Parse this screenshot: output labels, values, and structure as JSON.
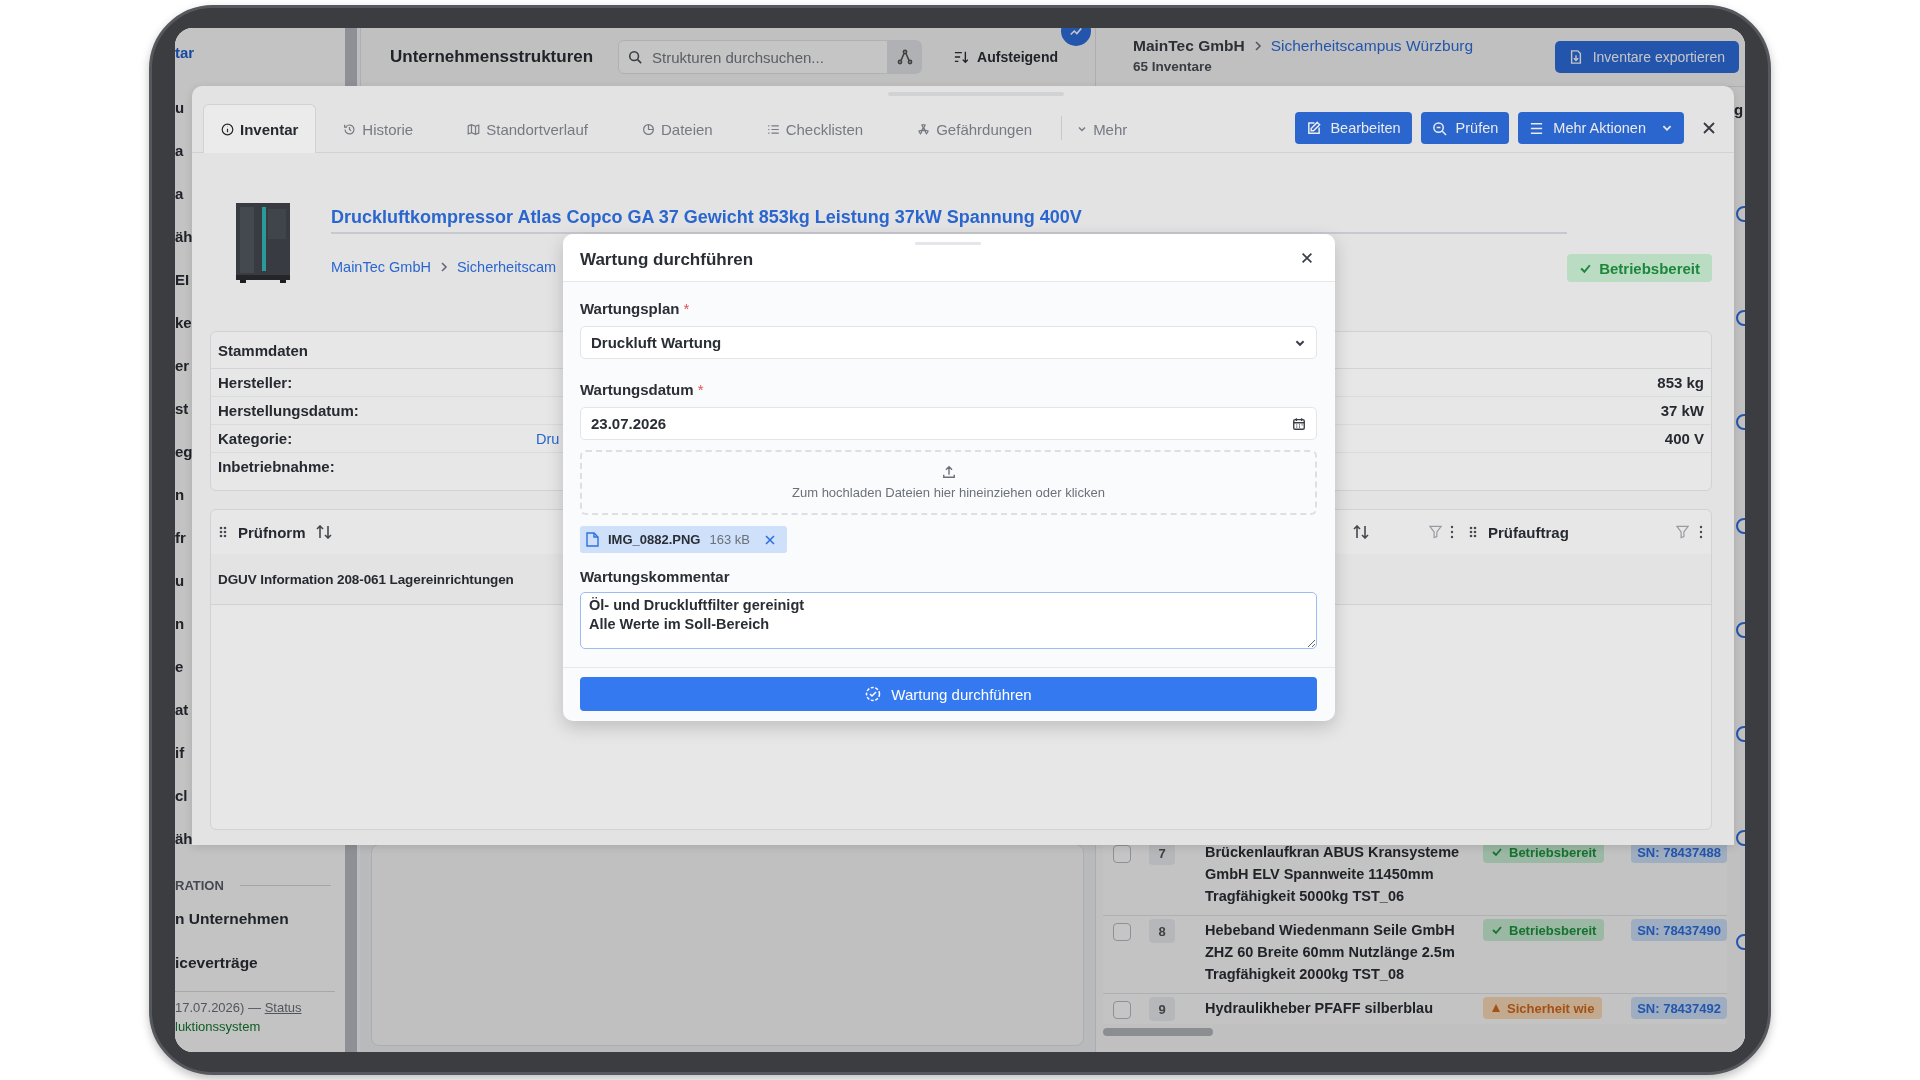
{
  "background": {
    "sidebar": {
      "top_link": "tar",
      "fragments": [
        "u",
        "a",
        "a",
        "äh",
        "EI",
        "ke",
        "er",
        "st",
        "eg",
        "n",
        "fr",
        "u",
        "n",
        "e",
        "at",
        "if",
        "cl",
        "äh"
      ],
      "section_label": "RATION",
      "items": [
        "n Unternehmen",
        "iceverträge"
      ],
      "footer": {
        "version": "17.07.2026) —",
        "status_link": "Status",
        "system": "luktionssystem"
      }
    },
    "structures": {
      "title": "Unternehmensstrukturen",
      "search": {
        "placeholder": "Strukturen durchsuchen..."
      },
      "sort": "Aufsteigend"
    },
    "inventory": {
      "company": "MainTec GmbH",
      "location": "Sicherheitscampus Würzburg",
      "count": "65 Inventare",
      "export": "Inventare exportieren",
      "edge_text": "g",
      "rows": [
        {
          "number": "7",
          "name": "Brückenlaufkran ABUS Kransysteme GmbH ELV Spannweite 11450mm Tragfähigkeit 5000kg TST_06",
          "checked": false,
          "status": {
            "label": "Betriebsbereit",
            "kind": "ready"
          },
          "serial": "SN: 78437488"
        },
        {
          "number": "8",
          "name": "Hebeband Wiedenmann Seile GmbH ZHZ 60 Breite 60mm Nutzlänge 2.5m Tragfähigkeit 2000kg TST_08",
          "checked": false,
          "status": {
            "label": "Betriebsbereit",
            "kind": "ready"
          },
          "serial": "SN: 78437490"
        },
        {
          "number": "9",
          "name": "Hydraulikheber PFAFF silberblau",
          "checked": false,
          "status": {
            "label": "Sicherheit wie",
            "kind": "warning"
          },
          "serial": "SN: 78437492"
        }
      ]
    }
  },
  "drawer": {
    "tabs": [
      {
        "label": "Inventar",
        "kind": "info",
        "selected": true
      },
      {
        "label": "Historie",
        "kind": "history",
        "selected": false
      },
      {
        "label": "Standortverlauf",
        "kind": "map",
        "selected": false
      },
      {
        "label": "Dateien",
        "kind": "files",
        "selected": false
      },
      {
        "label": "Checklisten",
        "kind": "checklist",
        "selected": false
      },
      {
        "label": "Gefährdungen",
        "kind": "hazard",
        "selected": false
      }
    ],
    "more": "Mehr",
    "actions": [
      {
        "label": "Bearbeiten",
        "kind": "edit"
      },
      {
        "label": "Prüfen",
        "kind": "inspect"
      },
      {
        "label": "Mehr Aktionen",
        "kind": "menu"
      }
    ],
    "asset": {
      "title": "Druckluftkompressor Atlas Copco GA 37 Gewicht 853kg Leistung 37kW Spannung 400V",
      "breadcrumb": [
        "MainTec GmbH",
        "Sicherheitscam"
      ],
      "status": "Betriebsbereit"
    },
    "master_data": {
      "title": "Stammdaten",
      "rows": [
        {
          "label": "Hersteller:",
          "value_right": "853 kg"
        },
        {
          "label": "Herstellungsdatum:",
          "value_right": "37 kW"
        },
        {
          "label": "Kategorie:",
          "value": "Dru",
          "value_right": "400 V"
        },
        {
          "label": "Inbetriebnahme:"
        }
      ]
    },
    "table": {
      "columns": [
        {
          "label": "Prüfnorm"
        },
        {
          "label": "Prüfauftrag"
        }
      ],
      "rows": [
        {
          "norm": "DGUV Information 208-061 Lagereinrichtungen"
        }
      ]
    }
  },
  "dialog": {
    "title": "Wartung durchführen",
    "fields": [
      {
        "kind": "select",
        "label": "Wartungsplan",
        "required_mark": "*",
        "value": "Druckluft Wartung"
      },
      {
        "kind": "date",
        "label": "Wartungsdatum",
        "required_mark": "*",
        "value": "23.07.2026"
      }
    ],
    "dropzone": "Zum hochladen Dateien hier hineinziehen oder klicken",
    "attachments": [
      {
        "name": "IMG_0882.PNG",
        "size": "163 kB"
      }
    ],
    "comment": {
      "label": "Wartungskommentar",
      "value": "Öl- und Druckluftfilter gereinigt\nAlle Werte im Soll-Bereich"
    },
    "submit": "Wartung durchführen"
  }
}
